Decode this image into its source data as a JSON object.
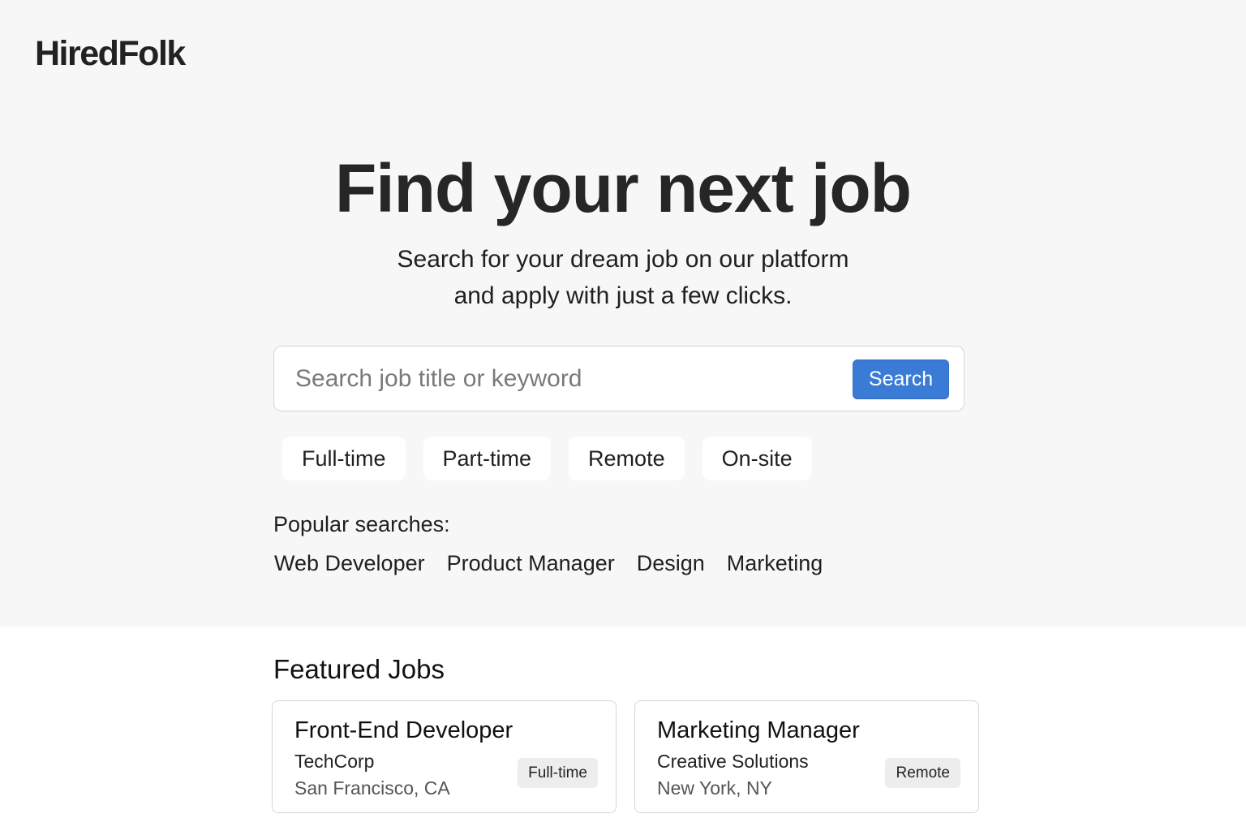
{
  "brand": {
    "logo": "HiredFolk"
  },
  "hero": {
    "title": "Find your next job",
    "subtitle_line1": "Search for your dream job on our platform",
    "subtitle_line2": "and apply with just a few clicks."
  },
  "search": {
    "placeholder": "Search job title or keyword",
    "value": "",
    "button_label": "Search",
    "button_color": "#3a7bd5"
  },
  "filters": [
    "Full-time",
    "Part-time",
    "Remote",
    "On-site"
  ],
  "popular": {
    "label": "Popular searches:",
    "items": [
      "Web Developer",
      "Product Manager",
      "Design",
      "Marketing"
    ]
  },
  "featured": {
    "title": "Featured Jobs",
    "jobs": [
      {
        "title": "Front-End Developer",
        "company": "TechCorp",
        "location": "San Francisco, CA",
        "type": "Full-time"
      },
      {
        "title": "Marketing Manager",
        "company": "Creative Solutions",
        "location": "New York, NY",
        "type": "Remote"
      }
    ]
  }
}
